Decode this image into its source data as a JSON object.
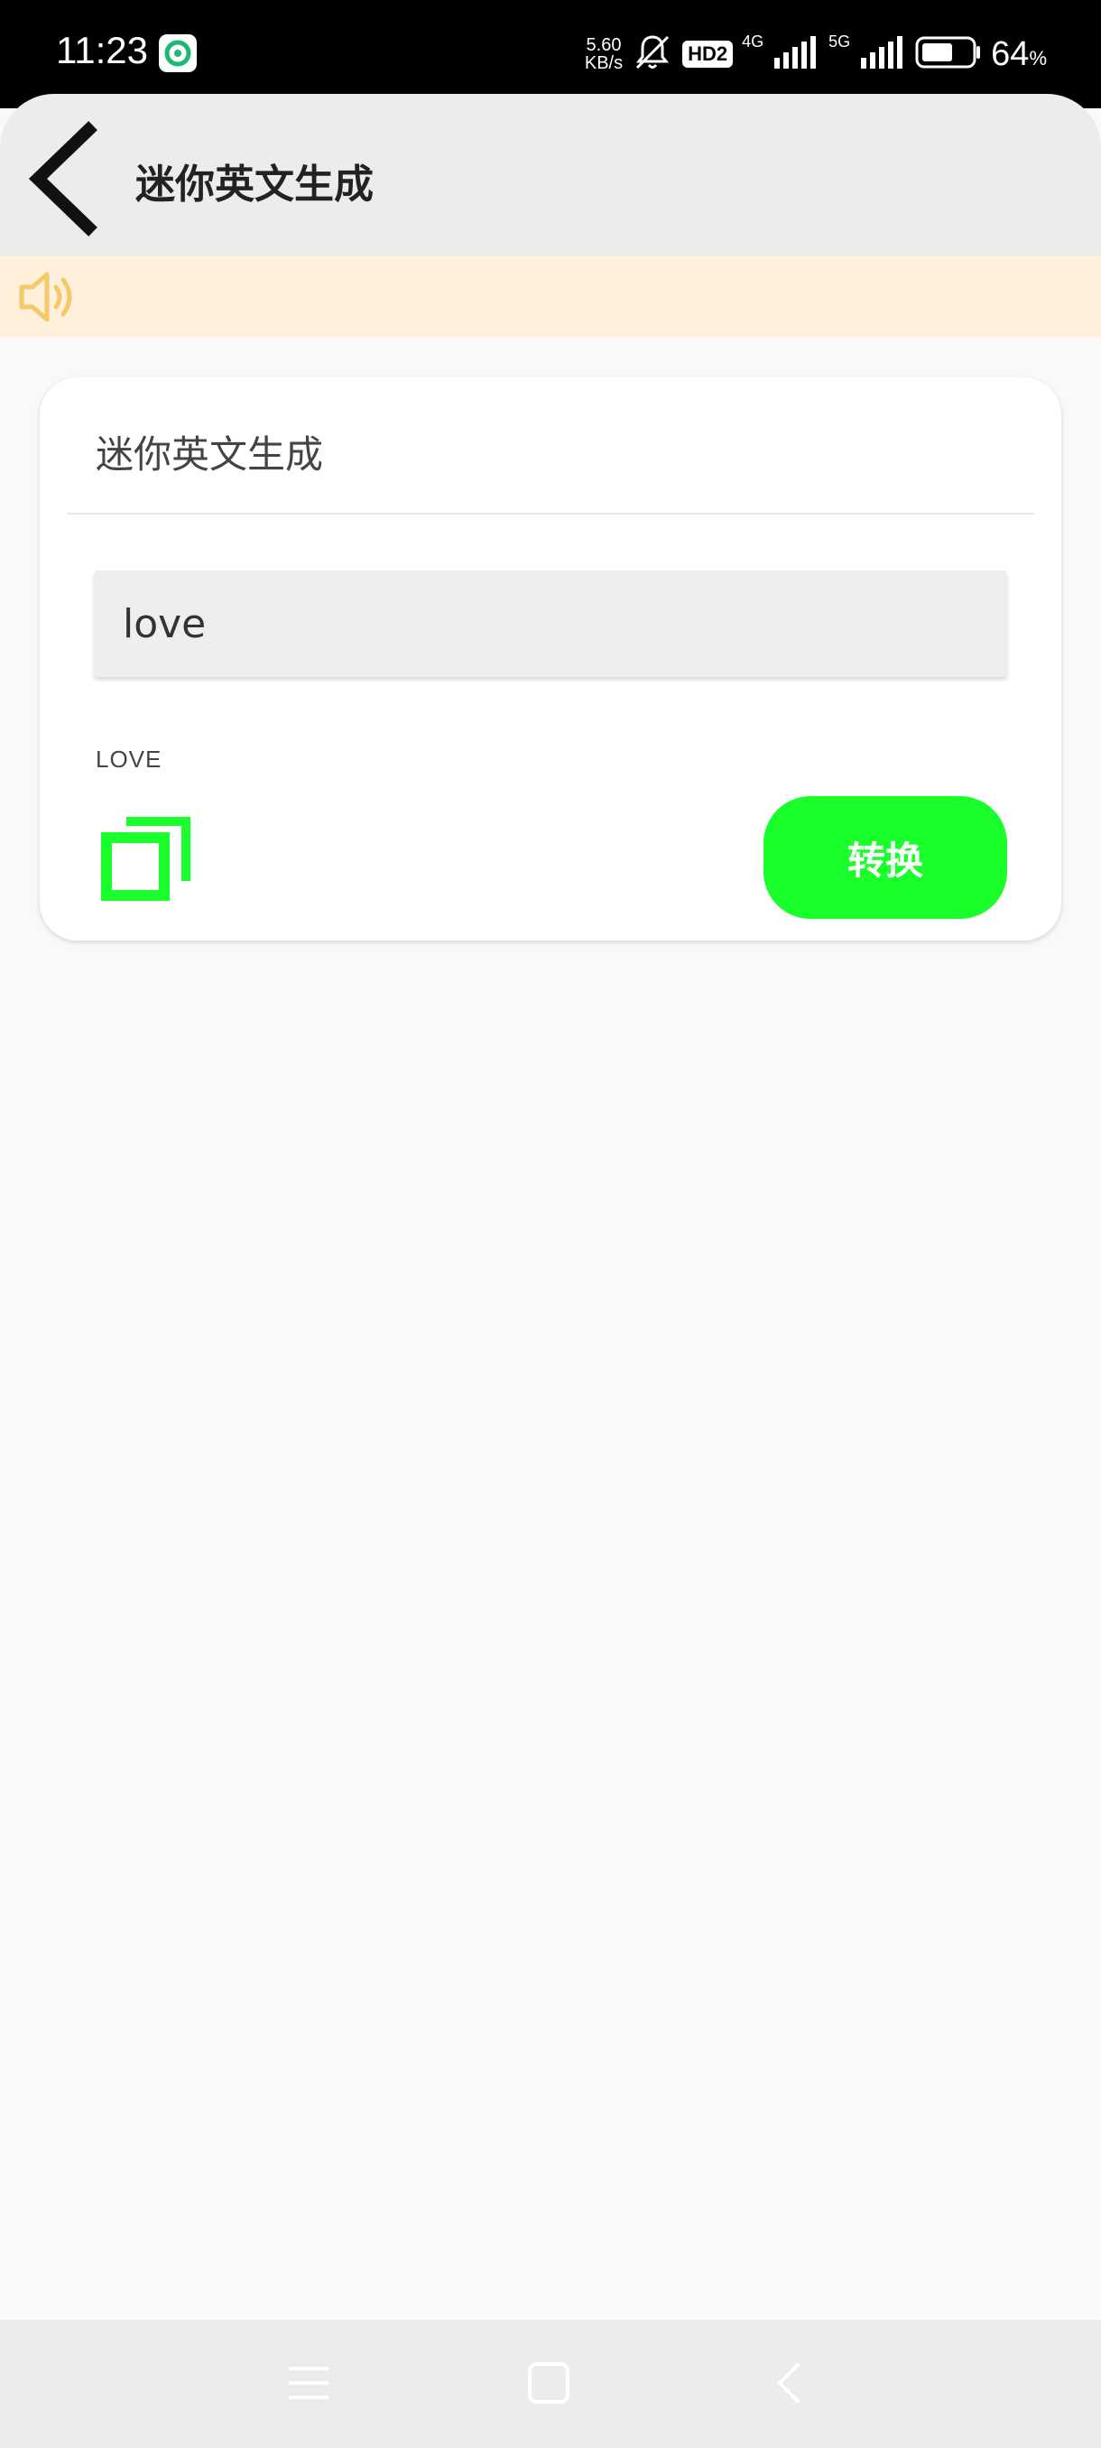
{
  "status_bar": {
    "time": "11:23",
    "speed_value": "5.60",
    "speed_unit": "KB/s",
    "hd_badge": "HD2",
    "net1": "4G",
    "net2": "5G",
    "battery_percent": "64",
    "battery_unit": "%",
    "battery_level": 0.64
  },
  "header": {
    "title": "迷你英文生成",
    "back_icon": "chevron-left-icon"
  },
  "notice": {
    "icon": "speaker-icon",
    "accent_color": "#f5c86a"
  },
  "card": {
    "title": "迷你英文生成",
    "input_value": "love",
    "result": "LOVE",
    "copy_icon": "copy-icon",
    "convert_label": "转换",
    "accent_color": "#1aff2c"
  },
  "nav_bar": {
    "icons": [
      "menu-icon",
      "home-icon",
      "back-icon"
    ]
  }
}
